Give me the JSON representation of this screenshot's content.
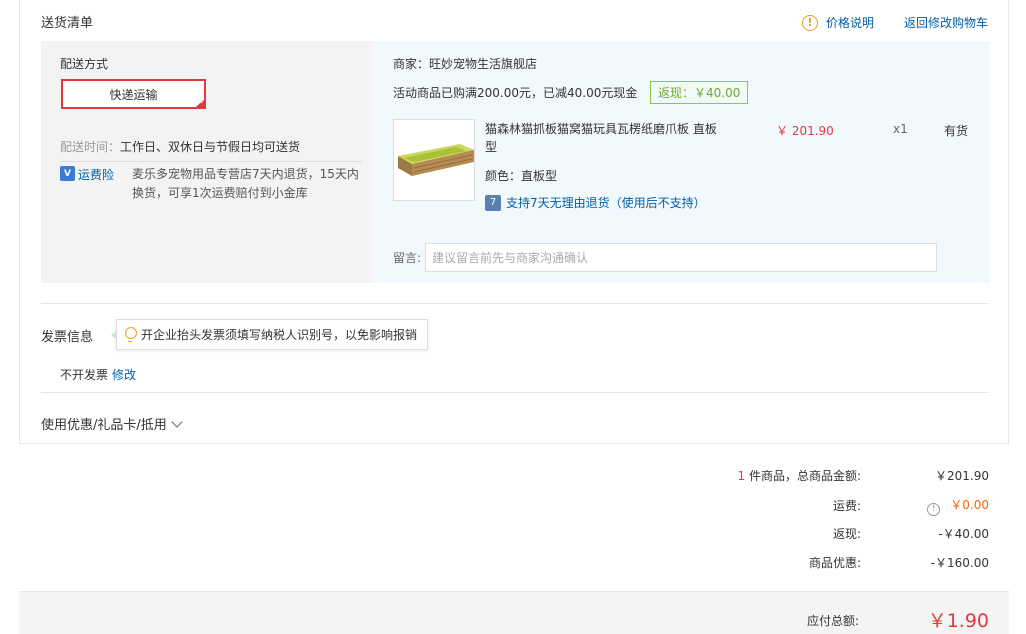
{
  "header": {
    "title": "送货清单",
    "price_note": "价格说明",
    "back_link": "返回修改购物车"
  },
  "delivery": {
    "label": "配送方式",
    "option": "快递运输",
    "time_key": "配送时间：",
    "time_value": "工作日、双休日与节假日均可送货",
    "insurance_label": "运费险",
    "insurance_text": "麦乐多宠物用品专营店7天内退货，15天内换货，可享1次运费赔付到小金库"
  },
  "shop": {
    "name": "商家：旺妙宠物生活旗舰店",
    "promo": "活动商品已购满200.00元，已减40.00元现金",
    "rebate": "返现：￥40.00"
  },
  "item": {
    "title": "猫森林猫抓板猫窝猫玩具瓦楞纸磨爪板 直板型",
    "price": "￥ 201.90",
    "qty": "x1",
    "stock": "有货",
    "color": "颜色：直板型",
    "return_policy": "支持7天无理由退货（使用后不支持）"
  },
  "remark": {
    "label": "留言:",
    "placeholder": "建议留言前先与商家沟通确认"
  },
  "invoice": {
    "title": "发票信息",
    "tip": "开企业抬头发票须填写纳税人识别号，以免影响报销",
    "value": "不开发票",
    "edit": "修改"
  },
  "coupon": {
    "label": "使用优惠/礼品卡/抵用"
  },
  "summary": {
    "count": "1",
    "goods_label": " 件商品，总商品金额:",
    "goods_value": "￥201.90",
    "shipping_label": "运费:",
    "shipping_value": "￥0.00",
    "rebate_label": "返现:",
    "rebate_value": "-￥40.00",
    "discount_label": "商品优惠:",
    "discount_value": "-￥160.00",
    "total_label": "应付总额:",
    "total_value": "￥1.90"
  }
}
